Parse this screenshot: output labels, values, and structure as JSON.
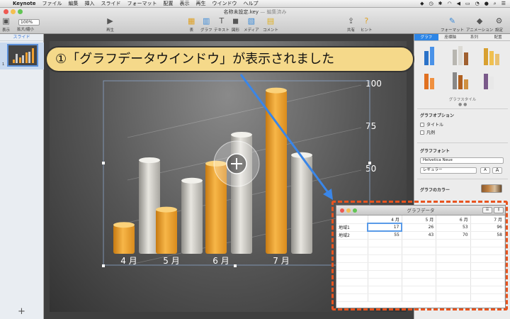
{
  "menubar": {
    "app_name": "Keynote",
    "items": [
      "ファイル",
      "編集",
      "挿入",
      "スライド",
      "フォーマット",
      "配置",
      "表示",
      "再生",
      "ウインドウ",
      "ヘルプ"
    ]
  },
  "toolbar": {
    "doc_title": "名称未設定.key",
    "doc_status": "— 編集済み",
    "zoom_value": "100%",
    "buttons": {
      "view": "表示",
      "zoom": "拡大/縮小",
      "play": "再生",
      "table": "表",
      "chart": "グラフ",
      "text": "テキスト",
      "shape": "図形",
      "media": "メディア",
      "comment": "コメント",
      "share": "共有",
      "tips": "ヒント",
      "format": "フォーマット",
      "animate": "アニメーション",
      "document": "設定"
    }
  },
  "sidebar": {
    "label": "スライド",
    "slide_number": "1",
    "add_icon": "+"
  },
  "slide": {
    "chart_data": {
      "type": "bar",
      "categories": [
        "4 月",
        "5 月",
        "6 月",
        "7 月"
      ],
      "series": [
        {
          "values": [
            17,
            26,
            53,
            96
          ],
          "color": "#f0a030"
        },
        {
          "values": [
            55,
            43,
            70,
            58
          ],
          "color": "#c8c6c0"
        }
      ],
      "ylim": [
        0,
        100
      ],
      "yticks": [
        "100",
        "75",
        "50"
      ]
    }
  },
  "callout": {
    "text": "①「グラフデータウインドウ」が表示されました"
  },
  "inspector": {
    "tabs": [
      "グラフ",
      "座標軸",
      "系列",
      "配置"
    ],
    "active_tab": "グラフ",
    "style_label": "グラフスタイル",
    "options_title": "グラフオプション",
    "opt_title": "タイトル",
    "opt_legend": "凡例",
    "font_title": "グラフフォント",
    "font_name": "Helvetica Neue",
    "font_weight": "レギュラー",
    "font_smaller": "A",
    "font_larger": "A",
    "colors_title": "グラフのカラー"
  },
  "data_window": {
    "title": "グラフデータ",
    "columns": [
      "4 月",
      "5 月",
      "6 月",
      "7 月"
    ],
    "rows": [
      {
        "label": "地域1",
        "values": [
          "17",
          "26",
          "53",
          "96"
        ]
      },
      {
        "label": "地域2",
        "values": [
          "55",
          "43",
          "70",
          "58"
        ]
      }
    ]
  }
}
